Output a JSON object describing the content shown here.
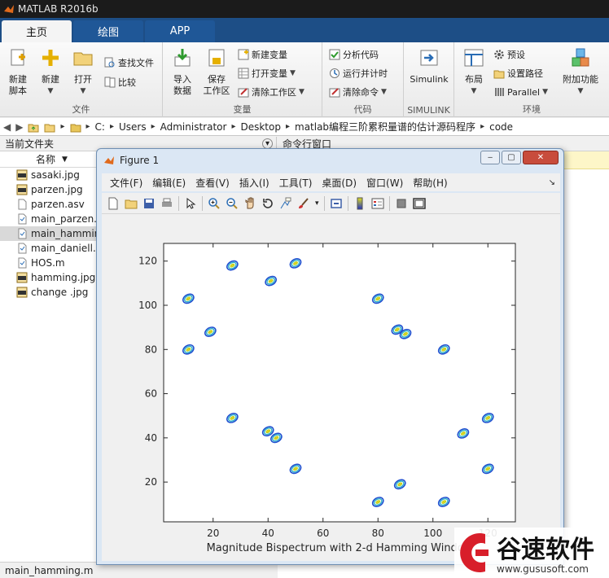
{
  "app": {
    "title": "MATLAB R2016b"
  },
  "tabs": [
    {
      "label": "主页",
      "active": true
    },
    {
      "label": "绘图",
      "active": false
    },
    {
      "label": "APP",
      "active": false
    }
  ],
  "ribbon": {
    "file_group": {
      "name": "文件",
      "new_script": "新建\n脚本",
      "new": "新建",
      "open": "打开",
      "find_files": "查找文件",
      "compare": "比较"
    },
    "variable_group": {
      "name": "变量",
      "import_data": "导入\n数据",
      "save_workspace": "保存\n工作区",
      "new_variable": "新建变量",
      "open_variable": "打开变量",
      "clear_workspace": "清除工作区"
    },
    "code_group": {
      "name": "代码",
      "analyze_code": "分析代码",
      "run_and_time": "运行并计时",
      "clear_commands": "清除命令"
    },
    "simulink_group": {
      "name": "SIMULINK",
      "simulink": "Simulink"
    },
    "env_group": {
      "name": "环境",
      "layout": "布局",
      "preferences": "预设",
      "set_path": "设置路径",
      "parallel": "Parallel",
      "addons": "附加功能"
    }
  },
  "address": {
    "segments": [
      "C:",
      "Users",
      "Administrator",
      "Desktop",
      "matlab编程三阶累积量谱的估计源码程序",
      "code"
    ]
  },
  "file_panel": {
    "title": "当前文件夹",
    "column": "名称",
    "files": [
      {
        "name": "sasaki.jpg",
        "type": "jpg"
      },
      {
        "name": "parzen.jpg",
        "type": "jpg"
      },
      {
        "name": "parzen.asv",
        "type": "asv"
      },
      {
        "name": "main_parzen.",
        "type": "m"
      },
      {
        "name": "main_hammin",
        "type": "m",
        "selected": true
      },
      {
        "name": "main_daniell.r",
        "type": "m"
      },
      {
        "name": "HOS.m",
        "type": "m"
      },
      {
        "name": "hamming.jpg",
        "type": "jpg"
      },
      {
        "name": "change .jpg",
        "type": "jpg"
      }
    ],
    "status": "main_hamming.m"
  },
  "command_panel": {
    "title": "命令行窗口"
  },
  "figure": {
    "title": "Figure 1",
    "menu": [
      "文件(F)",
      "编辑(E)",
      "查看(V)",
      "插入(I)",
      "工具(T)",
      "桌面(D)",
      "窗口(W)",
      "帮助(H)"
    ],
    "tools": [
      "new-figure-icon",
      "open-icon",
      "save-icon",
      "print-icon",
      "pointer-icon",
      "zoom-in-icon",
      "zoom-out-icon",
      "pan-icon",
      "rotate-icon",
      "data-cursor-icon",
      "brush-icon",
      "link-icon",
      "colorbar-icon",
      "legend-icon",
      "hide-plot-tools-icon",
      "show-plot-tools-icon"
    ]
  },
  "chart_data": {
    "type": "scatter",
    "title": "",
    "xlabel": "Magnitude Bispectrum with 2-d Hamming Window",
    "ylabel": "",
    "xlim": [
      2,
      130
    ],
    "ylim": [
      2,
      128
    ],
    "xticks": [
      20,
      40,
      60,
      80,
      100,
      120
    ],
    "yticks": [
      20,
      40,
      60,
      80,
      100,
      120
    ],
    "grid": false,
    "description_style": "contour blobs",
    "points": [
      {
        "x": 27,
        "y": 118
      },
      {
        "x": 41,
        "y": 111
      },
      {
        "x": 50,
        "y": 119
      },
      {
        "x": 11,
        "y": 103
      },
      {
        "x": 19,
        "y": 88
      },
      {
        "x": 11,
        "y": 80
      },
      {
        "x": 80,
        "y": 103
      },
      {
        "x": 87,
        "y": 89
      },
      {
        "x": 90,
        "y": 87
      },
      {
        "x": 104,
        "y": 80
      },
      {
        "x": 27,
        "y": 49
      },
      {
        "x": 40,
        "y": 43
      },
      {
        "x": 43,
        "y": 40
      },
      {
        "x": 50,
        "y": 26
      },
      {
        "x": 111,
        "y": 42
      },
      {
        "x": 120,
        "y": 49
      },
      {
        "x": 120,
        "y": 26
      },
      {
        "x": 88,
        "y": 19
      },
      {
        "x": 80,
        "y": 11
      },
      {
        "x": 104,
        "y": 11
      }
    ]
  },
  "colors": {
    "contour_outer": "#1f4fd0",
    "contour_mid": "#2db0c8",
    "contour_inner": "#d8d820",
    "ribbon_blue": "#1d4e86"
  },
  "watermark": {
    "text": "谷速软件",
    "url": "www.gususoft.com"
  }
}
